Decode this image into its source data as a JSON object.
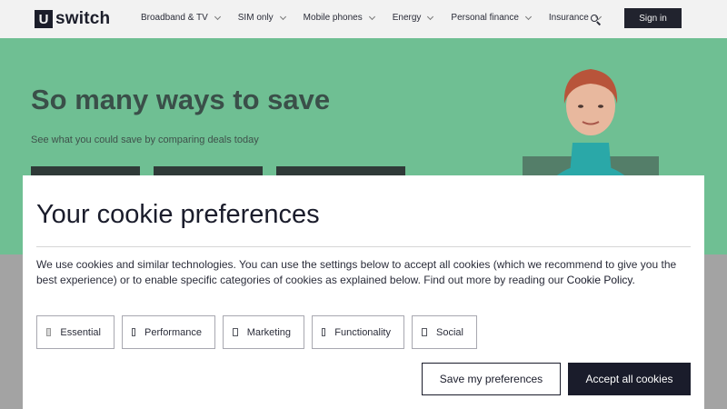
{
  "header": {
    "logo_letter": "U",
    "logo_word": "switch",
    "nav": [
      {
        "label": "Broadband & TV"
      },
      {
        "label": "SIM only"
      },
      {
        "label": "Mobile phones"
      },
      {
        "label": "Energy"
      },
      {
        "label": "Personal finance"
      },
      {
        "label": "Insurance"
      }
    ],
    "search_icon": "search-icon",
    "signin_label": "Sign in"
  },
  "hero": {
    "title": "So many ways to save",
    "subtitle": "See what you could save by comparing deals today",
    "background": "#6fbf93"
  },
  "cookie": {
    "title": "Your cookie preferences",
    "text": "We use cookies and similar technologies. You can use the settings below to accept all cookies (which we recommend to give you the best experience) or to enable specific categories of cookies as explained below. Find out more by reading our ",
    "link": "Cookie Policy.",
    "categories": [
      {
        "label": "Essential",
        "checked": true,
        "disabled": true
      },
      {
        "label": "Performance",
        "checked": false
      },
      {
        "label": "Marketing",
        "checked": false
      },
      {
        "label": "Functionality",
        "checked": false
      },
      {
        "label": "Social",
        "checked": false
      }
    ],
    "save_label": "Save my preferences",
    "accept_label": "Accept all cookies"
  },
  "colors": {
    "brand_dark": "#1a1c2b",
    "hero_green": "#6fbf93"
  }
}
